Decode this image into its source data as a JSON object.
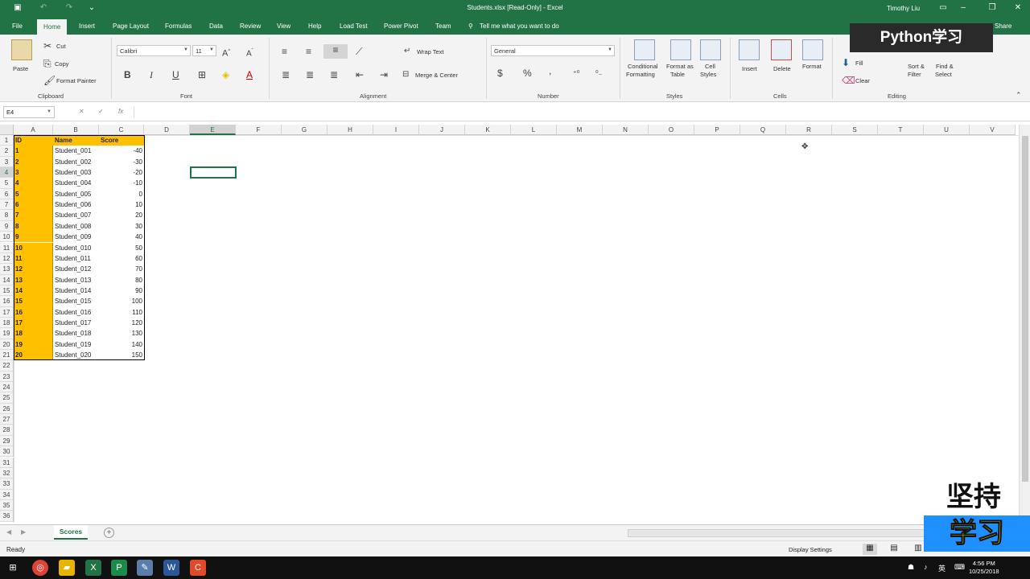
{
  "window": {
    "title": "Students.xlsx  [Read-Only]  -  Excel",
    "user": "Timothy Liu"
  },
  "tabs": [
    "File",
    "Home",
    "Insert",
    "Page Layout",
    "Formulas",
    "Data",
    "Review",
    "View",
    "Help",
    "Load Test",
    "Power Pivot",
    "Team"
  ],
  "active_tab": "Home",
  "tell_me": "Tell me what you want to do",
  "share": "Share",
  "ribbon": {
    "clipboard": {
      "label": "Clipboard",
      "paste": "Paste",
      "cut": "Cut",
      "copy": "Copy",
      "format_painter": "Format Painter"
    },
    "font": {
      "label": "Font",
      "name": "Calibri",
      "size": "11",
      "bold": "B",
      "italic": "I",
      "underline": "U"
    },
    "alignment": {
      "label": "Alignment",
      "wrap_text": "Wrap Text",
      "merge_center": "Merge & Center"
    },
    "number": {
      "label": "Number",
      "format": "General",
      "currency": "$",
      "percent": "%",
      "comma": ","
    },
    "styles": {
      "label": "Styles",
      "conditional": "Conditional",
      "conditional2": "Formatting",
      "format_table": "Format as",
      "format_table2": "Table",
      "cell_styles": "Cell",
      "cell_styles2": "Styles"
    },
    "cells": {
      "label": "Cells",
      "insert": "Insert",
      "delete": "Delete",
      "format": "Format"
    },
    "editing": {
      "label": "Editing",
      "fill": "Fill",
      "clear": "Clear",
      "sort": "Sort &",
      "sort2": "Filter",
      "find": "Find &",
      "find2": "Select"
    }
  },
  "formula_bar": {
    "name_box": "E4",
    "fx": "fx",
    "cancel": "✕",
    "enter": "✓",
    "content": ""
  },
  "columns": [
    "A",
    "B",
    "C",
    "D",
    "E",
    "F",
    "G",
    "H",
    "I",
    "J",
    "K",
    "L",
    "M",
    "N",
    "O",
    "P",
    "Q",
    "R",
    "S",
    "T",
    "U",
    "V"
  ],
  "rows": [
    "1",
    "2",
    "3",
    "4",
    "5",
    "6",
    "7",
    "8",
    "9",
    "10",
    "11",
    "12",
    "13",
    "14",
    "15",
    "16",
    "17",
    "18",
    "19",
    "20",
    "21",
    "22",
    "23",
    "24",
    "25",
    "26",
    "27",
    "28",
    "29",
    "30",
    "31",
    "32",
    "33",
    "34",
    "35",
    "36"
  ],
  "selected_cell": "E4",
  "table": {
    "headers": [
      "ID",
      "Name",
      "Score"
    ],
    "rows": [
      [
        "1",
        "Student_001",
        "-40"
      ],
      [
        "2",
        "Student_002",
        "-30"
      ],
      [
        "3",
        "Student_003",
        "-20"
      ],
      [
        "4",
        "Student_004",
        "-10"
      ],
      [
        "5",
        "Student_005",
        "0"
      ],
      [
        "6",
        "Student_006",
        "10"
      ],
      [
        "7",
        "Student_007",
        "20"
      ],
      [
        "8",
        "Student_008",
        "30"
      ],
      [
        "9",
        "Student_009",
        "40"
      ],
      [
        "10",
        "Student_010",
        "50"
      ],
      [
        "11",
        "Student_011",
        "60"
      ],
      [
        "12",
        "Student_012",
        "70"
      ],
      [
        "13",
        "Student_013",
        "80"
      ],
      [
        "14",
        "Student_014",
        "90"
      ],
      [
        "15",
        "Student_015",
        "100"
      ],
      [
        "16",
        "Student_016",
        "110"
      ],
      [
        "17",
        "Student_017",
        "120"
      ],
      [
        "18",
        "Student_018",
        "130"
      ],
      [
        "19",
        "Student_019",
        "140"
      ],
      [
        "20",
        "Student_020",
        "150"
      ]
    ]
  },
  "sheet_tab": "Scores",
  "status": {
    "ready": "Ready",
    "display_settings": "Display Settings"
  },
  "taskbar": {
    "time": "4:56 PM",
    "date": "10/25/2018",
    "lang": "英"
  },
  "overlay": {
    "badge": "Python学习",
    "line1": "坚持",
    "line2": "学习"
  },
  "colors": {
    "excel_green": "#217346",
    "header_fill": "#ffc000",
    "overlay_blue": "#1e90ff",
    "overlay_yellow": "#f5e400"
  }
}
